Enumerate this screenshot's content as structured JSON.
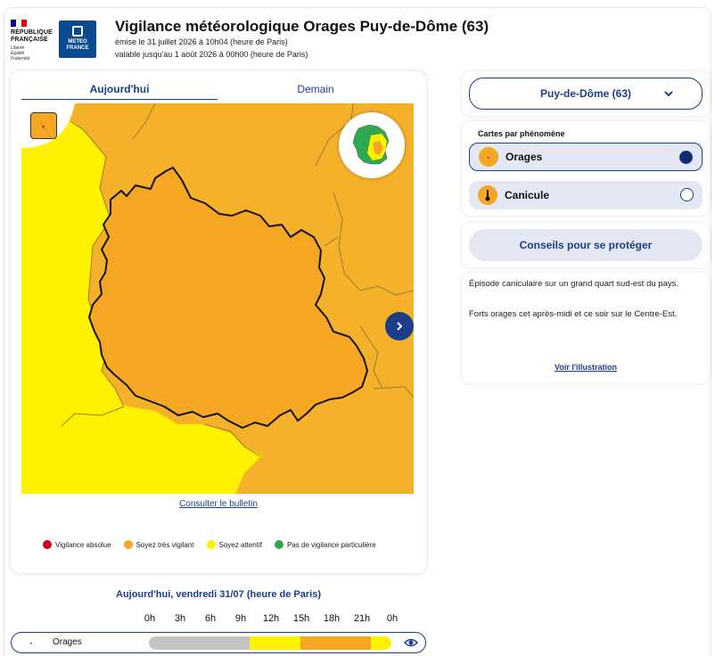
{
  "header": {
    "republique_lines": [
      "RÉPUBLIQUE",
      "FRANÇAISE"
    ],
    "republique_motto": [
      "Liberté",
      "Égalité",
      "Fraternité"
    ],
    "meteo_logo": [
      "METEO",
      "FRANCE"
    ],
    "title": "Vigilance météorologique Orages Puy-de-Dôme (63)",
    "issued": "émise le 31 juillet 2026 à 10h04 (heure de Paris)",
    "valid": "valable jusqu'au 1 août 2026 à 00h00 (heure de Paris)"
  },
  "tabs": [
    {
      "label": "Aujourd'hui",
      "active": true
    },
    {
      "label": "Demain",
      "active": false
    }
  ],
  "map": {
    "phenomenon_icon": "lightning-icon",
    "department_level_color": "#f5b12a",
    "neighbor_yellow": "#fff200"
  },
  "bulletin_link": "Consulter le bulletin",
  "legend": [
    {
      "label": "Vigilance absolue",
      "color": "#d0021b"
    },
    {
      "label": "Soyez très vigilant",
      "color": "#f5a623"
    },
    {
      "label": "Soyez attentif",
      "color": "#fff200"
    },
    {
      "label": "Pas de vigilance particulière",
      "color": "#2fa84f"
    }
  ],
  "department_select": "Puy-de-Dôme (63)",
  "phenomena": {
    "label": "Cartes par phénomène",
    "items": [
      {
        "name": "Orages",
        "icon": "lightning-icon",
        "selected": true
      },
      {
        "name": "Canicule",
        "icon": "thermometer-icon",
        "selected": false
      }
    ]
  },
  "advice_button": "Conseils pour se protéger",
  "info": {
    "p1": "Épisode caniculaire sur un grand quart sud-est du pays.",
    "p2": "Forts orages cet après-midi et ce soir sur le Centre-Est.",
    "link": "Voir l'illustration"
  },
  "timeline": {
    "title": "Aujourd'hui, vendredi 31/07 (heure de Paris)",
    "hours": [
      "0h",
      "3h",
      "6h",
      "9h",
      "12h",
      "15h",
      "18h",
      "21h",
      "0h"
    ],
    "row_label": "Orages",
    "segments": [
      {
        "from": "0h",
        "to": "12h",
        "level": "passed",
        "color": "#c4c4c4"
      },
      {
        "from": "12h",
        "to": "18h",
        "level": "Soyez attentif",
        "color": "#fff200"
      },
      {
        "from": "18h",
        "to": "24h",
        "level": "Soyez très vigilant",
        "color": "#f5a623"
      },
      {
        "from": "24h",
        "to": "0h",
        "level": "Soyez attentif",
        "color": "#fff200"
      }
    ]
  }
}
